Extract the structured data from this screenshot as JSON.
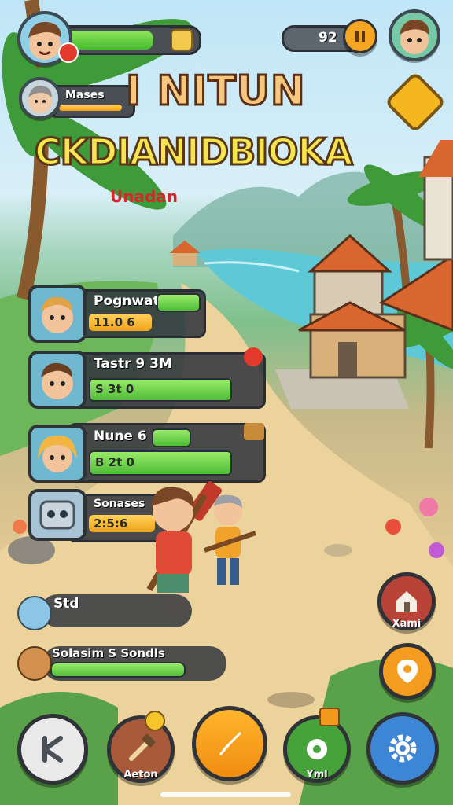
{
  "player": {
    "avatar_icon": "boy-face-icon"
  },
  "top_right": {
    "counter": "92",
    "pause_icon": "pause-icon",
    "friend_icon": "boy-face-icon"
  },
  "secondary_player": {
    "name": "Mases"
  },
  "title": {
    "line1": "I NITUN",
    "line2": "CKDIANIDBIOKA",
    "subtitle": "Unadan"
  },
  "characters": [
    {
      "name": "Pognwat",
      "value": "11.0 6"
    },
    {
      "name": "Tastr 9 3M",
      "value": "S 3t 0"
    },
    {
      "name": "Nune 6 830",
      "value": "B 2t 0"
    },
    {
      "name": "Sonases",
      "value": "2:5:6"
    }
  ],
  "bottom_status": [
    {
      "name": "Std"
    },
    {
      "name": "Solasim S Sondls"
    }
  ],
  "right_buttons": [
    {
      "label": "Xami"
    },
    {
      "label": ""
    }
  ],
  "bottom_nav": [
    {
      "label": ""
    },
    {
      "label": "Aeton"
    },
    {
      "label": ""
    },
    {
      "label": "Yml"
    },
    {
      "label": ""
    }
  ],
  "progress": {
    "player_health": 0.9,
    "secondary": 0.75,
    "char1": 0.85,
    "char2": 0.95,
    "char3": 0.3,
    "status2": 0.9
  },
  "colors": {
    "bar_green": "#4fbd36",
    "bar_yellow": "#f0a21c",
    "title_red": "#d7262a",
    "title_yellow": "#f6e64d"
  }
}
